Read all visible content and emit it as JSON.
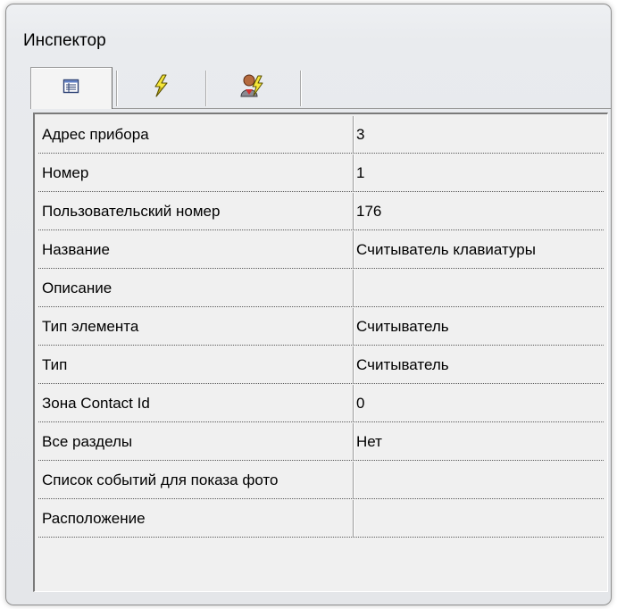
{
  "window": {
    "title": "Инспектор"
  },
  "tabs": [
    {
      "name": "properties",
      "icon": "property-list-icon",
      "active": true
    },
    {
      "name": "events",
      "icon": "lightning-icon",
      "active": false
    },
    {
      "name": "user-events",
      "icon": "user-lightning-icon",
      "active": false
    }
  ],
  "properties": [
    {
      "name": "Адрес прибора",
      "value": "3"
    },
    {
      "name": "Номер",
      "value": "1"
    },
    {
      "name": "Пользовательский номер",
      "value": "176"
    },
    {
      "name": "Название",
      "value": "Считыватель клавиатуры"
    },
    {
      "name": "Описание",
      "value": ""
    },
    {
      "name": "Тип элемента",
      "value": "Считыватель"
    },
    {
      "name": "Тип",
      "value": "Считыватель"
    },
    {
      "name": "Зона Contact Id",
      "value": "0"
    },
    {
      "name": "Все разделы",
      "value": "Нет"
    },
    {
      "name": "Список событий для показа фото",
      "value": ""
    },
    {
      "name": "Расположение",
      "value": ""
    }
  ]
}
